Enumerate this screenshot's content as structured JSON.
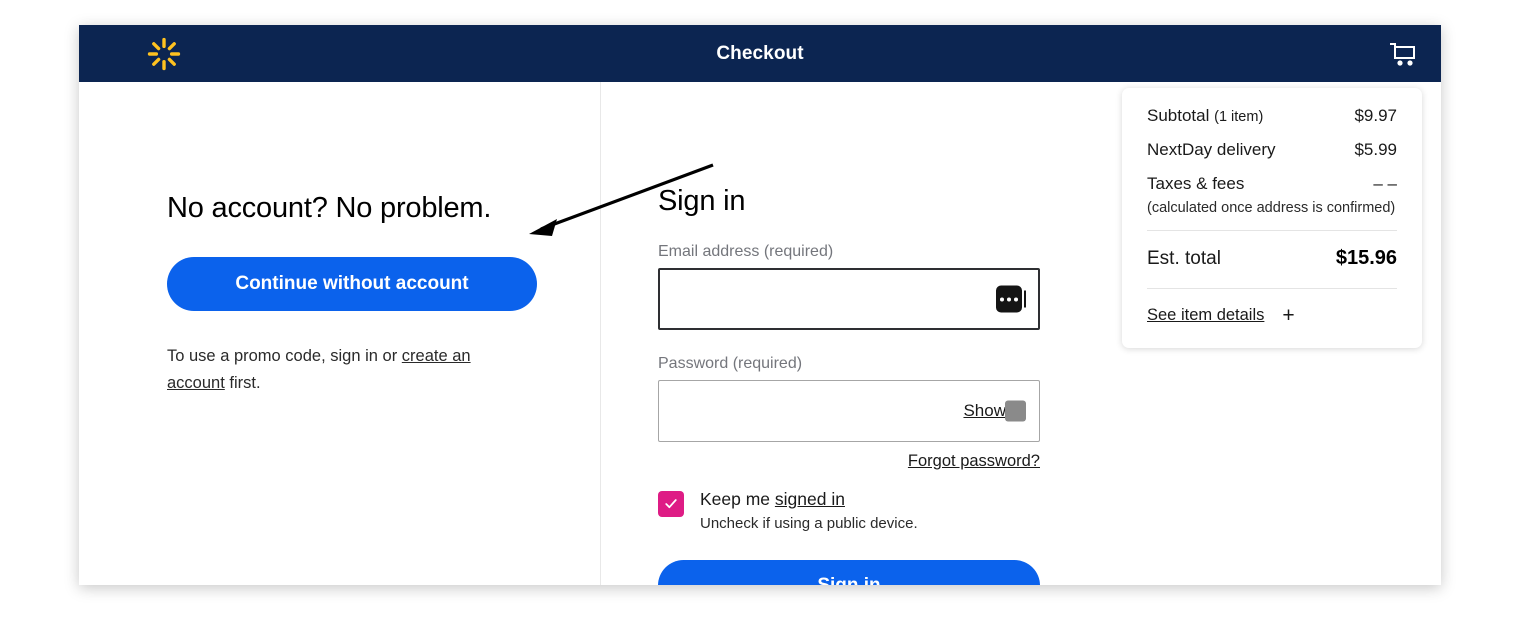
{
  "header": {
    "logo_icon": "walmart-spark-icon",
    "title": "Checkout",
    "cart_icon": "shopping-cart-icon"
  },
  "guest": {
    "heading": "No account? No problem.",
    "continue_label": "Continue without account",
    "promo_prefix": "To use a promo code, sign in or ",
    "promo_link": "create an account",
    "promo_suffix": " first."
  },
  "annotation": {
    "arrow_icon": "arrow-pointing-left-icon"
  },
  "signin": {
    "heading": "Sign in",
    "email_label": "Email address (required)",
    "email_value": "",
    "email_placeholder": "",
    "email_autofill_icon": "password-manager-icon",
    "password_label": "Password (required)",
    "password_value": "",
    "password_placeholder": "",
    "show_label": "Show",
    "password_badge_icon": "password-manager-icon",
    "forgot_label": "Forgot password?",
    "keep_checked": true,
    "keep_check_icon": "checkmark-icon",
    "keep_prefix": "Keep me ",
    "keep_link": "signed in",
    "keep_sub": "Uncheck if using a public device.",
    "submit_label": "Sign in",
    "checkbox_color": "#de1c85",
    "button_color": "#0b62ec"
  },
  "summary": {
    "rows": [
      {
        "label": "Subtotal",
        "qty": "(1 item)",
        "value": "$9.97"
      },
      {
        "label": "NextDay delivery",
        "qty": "",
        "value": "$5.99"
      },
      {
        "label": "Taxes & fees",
        "qty": "",
        "value": "– –"
      }
    ],
    "tax_note": "(calculated once address is confirmed)",
    "total_label": "Est. total",
    "total_value": "$15.96",
    "details_label": "See item details",
    "details_icon": "plus-icon",
    "details_plus": "+"
  }
}
